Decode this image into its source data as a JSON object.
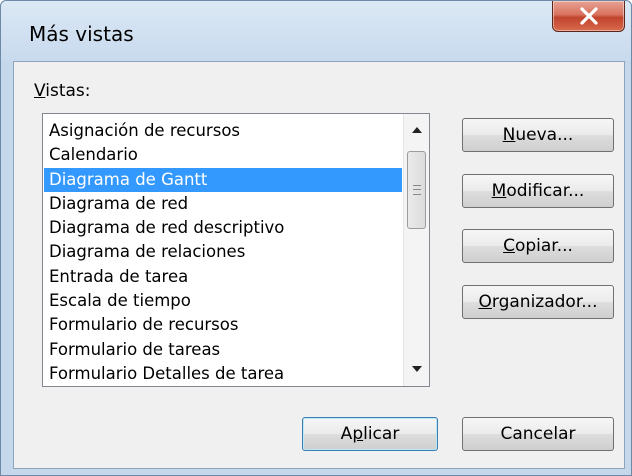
{
  "window": {
    "title": "Más vistas"
  },
  "list": {
    "label": "Vistas:",
    "items": [
      "Asignación de recursos",
      "Calendario",
      "Diagrama de Gantt",
      "Diagrama de red",
      "Diagrama de red descriptivo",
      "Diagrama de relaciones",
      "Entrada de tarea",
      "Escala de tiempo",
      "Formulario de recursos",
      "Formulario de tareas",
      "Formulario Detalles de tarea"
    ],
    "selected_item": "Diagrama de Gantt"
  },
  "buttons": {
    "new": "Nueva...",
    "modify": "Modificar...",
    "copy": "Copiar...",
    "organizer": "Organizador...",
    "apply": "Aplicar",
    "cancel": "Cancelar"
  },
  "icons": {
    "close": "close-icon",
    "scroll_up": "arrow-up-icon",
    "scroll_down": "arrow-down-icon"
  },
  "colors": {
    "selection": "#3399ff",
    "close_button": "#c8452e"
  }
}
